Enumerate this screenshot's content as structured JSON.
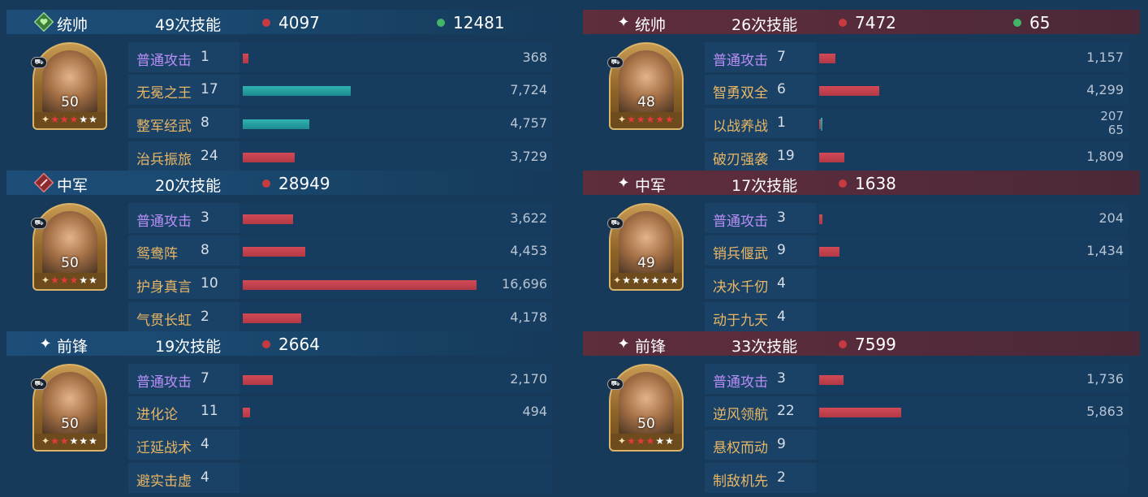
{
  "teams": [
    {
      "side": "left",
      "squads": [
        {
          "role": "统帅",
          "role_icon": "green-heart-diamond-icon",
          "skill_count": "49次技能",
          "damage": "4097",
          "heal": "12481",
          "level": "50",
          "stars": "★★★★★",
          "red_stars": 3,
          "skills": [
            {
              "name": "普通攻击",
              "type": "normal",
              "times": "1",
              "value": "368",
              "bar_fraction": 0.024,
              "bar_color": "red"
            },
            {
              "name": "无冕之王",
              "type": "tactic",
              "times": "17",
              "value": "7,724",
              "bar_fraction": 0.463,
              "bar_color": "teal"
            },
            {
              "name": "整军经武",
              "type": "tactic",
              "times": "8",
              "value": "4,757",
              "bar_fraction": 0.285,
              "bar_color": "teal"
            },
            {
              "name": "治兵振旅",
              "type": "tactic",
              "times": "24",
              "value": "3,729",
              "bar_fraction": 0.223,
              "bar_color": "red"
            }
          ]
        },
        {
          "role": "中军",
          "role_icon": "red-sword-diamond-icon",
          "skill_count": "20次技能",
          "damage": "28949",
          "level": "50",
          "stars": "★★★★★",
          "red_stars": 3,
          "skills": [
            {
              "name": "普通攻击",
              "type": "normal",
              "times": "3",
              "value": "3,622",
              "bar_fraction": 0.217,
              "bar_color": "red"
            },
            {
              "name": "鸳鸯阵",
              "type": "tactic",
              "times": "8",
              "value": "4,453",
              "bar_fraction": 0.267,
              "bar_color": "red"
            },
            {
              "name": "护身真言",
              "type": "tactic",
              "times": "10",
              "value": "16,696",
              "bar_fraction": 1.0,
              "bar_color": "red"
            },
            {
              "name": "气贯长虹",
              "type": "tactic",
              "times": "2",
              "value": "4,178",
              "bar_fraction": 0.25,
              "bar_color": "red"
            }
          ]
        },
        {
          "role": "前锋",
          "role_icon": "sparkle-icon",
          "skill_count": "19次技能",
          "damage": "2664",
          "level": "50",
          "stars": "★★★★★",
          "red_stars": 2,
          "skills": [
            {
              "name": "普通攻击",
              "type": "normal",
              "times": "7",
              "value": "2,170",
              "bar_fraction": 0.13,
              "bar_color": "red"
            },
            {
              "name": "进化论",
              "type": "tactic",
              "times": "11",
              "value": "494",
              "bar_fraction": 0.03,
              "bar_color": "red"
            },
            {
              "name": "迁延战术",
              "type": "tactic",
              "times": "4",
              "value": "",
              "bar_fraction": 0,
              "bar_color": "red"
            },
            {
              "name": "避实击虚",
              "type": "tactic",
              "times": "4",
              "value": "",
              "bar_fraction": 0,
              "bar_color": "red"
            }
          ]
        }
      ]
    },
    {
      "side": "right",
      "squads": [
        {
          "role": "统帅",
          "role_icon": "sparkle-icon",
          "skill_count": "26次技能",
          "damage": "7472",
          "heal": "65",
          "level": "48",
          "stars": "★★★★★",
          "red_stars": 5,
          "skills": [
            {
              "name": "普通攻击",
              "type": "normal",
              "times": "7",
              "value": "1,157",
              "bar_fraction": 0.069,
              "bar_color": "red"
            },
            {
              "name": "智勇双全",
              "type": "tactic",
              "times": "6",
              "value": "4,299",
              "bar_fraction": 0.257,
              "bar_color": "red"
            },
            {
              "name": "以战养战",
              "type": "tactic",
              "times": "1",
              "value": "207",
              "value2": "65",
              "bar_fraction": 0.012,
              "bar_color": "red"
            },
            {
              "name": "破刃强袭",
              "type": "tactic",
              "times": "19",
              "value": "1,809",
              "bar_fraction": 0.108,
              "bar_color": "red"
            }
          ]
        },
        {
          "role": "中军",
          "role_icon": "sparkle-icon",
          "skill_count": "17次技能",
          "damage": "1638",
          "level": "49",
          "stars": "★★★★★★",
          "red_stars": 0,
          "skills": [
            {
              "name": "普通攻击",
              "type": "normal",
              "times": "3",
              "value": "204",
              "bar_fraction": 0.012,
              "bar_color": "red"
            },
            {
              "name": "销兵偃武",
              "type": "tactic",
              "times": "9",
              "value": "1,434",
              "bar_fraction": 0.086,
              "bar_color": "red"
            },
            {
              "name": "决水千仞",
              "type": "tactic",
              "times": "4",
              "value": "",
              "bar_fraction": 0,
              "bar_color": "red"
            },
            {
              "name": "动于九天",
              "type": "tactic",
              "times": "4",
              "value": "",
              "bar_fraction": 0,
              "bar_color": "red"
            }
          ]
        },
        {
          "role": "前锋",
          "role_icon": "sparkle-icon",
          "skill_count": "33次技能",
          "damage": "7599",
          "level": "50",
          "stars": "★★★★★",
          "red_stars": 3,
          "skills": [
            {
              "name": "普通攻击",
              "type": "normal",
              "times": "3",
              "value": "1,736",
              "bar_fraction": 0.104,
              "bar_color": "red"
            },
            {
              "name": "逆风领航",
              "type": "tactic",
              "times": "22",
              "value": "5,863",
              "bar_fraction": 0.351,
              "bar_color": "red"
            },
            {
              "name": "悬权而动",
              "type": "tactic",
              "times": "9",
              "value": "",
              "bar_fraction": 0,
              "bar_color": "red"
            },
            {
              "name": "制敌机先",
              "type": "tactic",
              "times": "2",
              "value": "",
              "bar_fraction": 0,
              "bar_color": "red"
            }
          ]
        }
      ]
    }
  ]
}
